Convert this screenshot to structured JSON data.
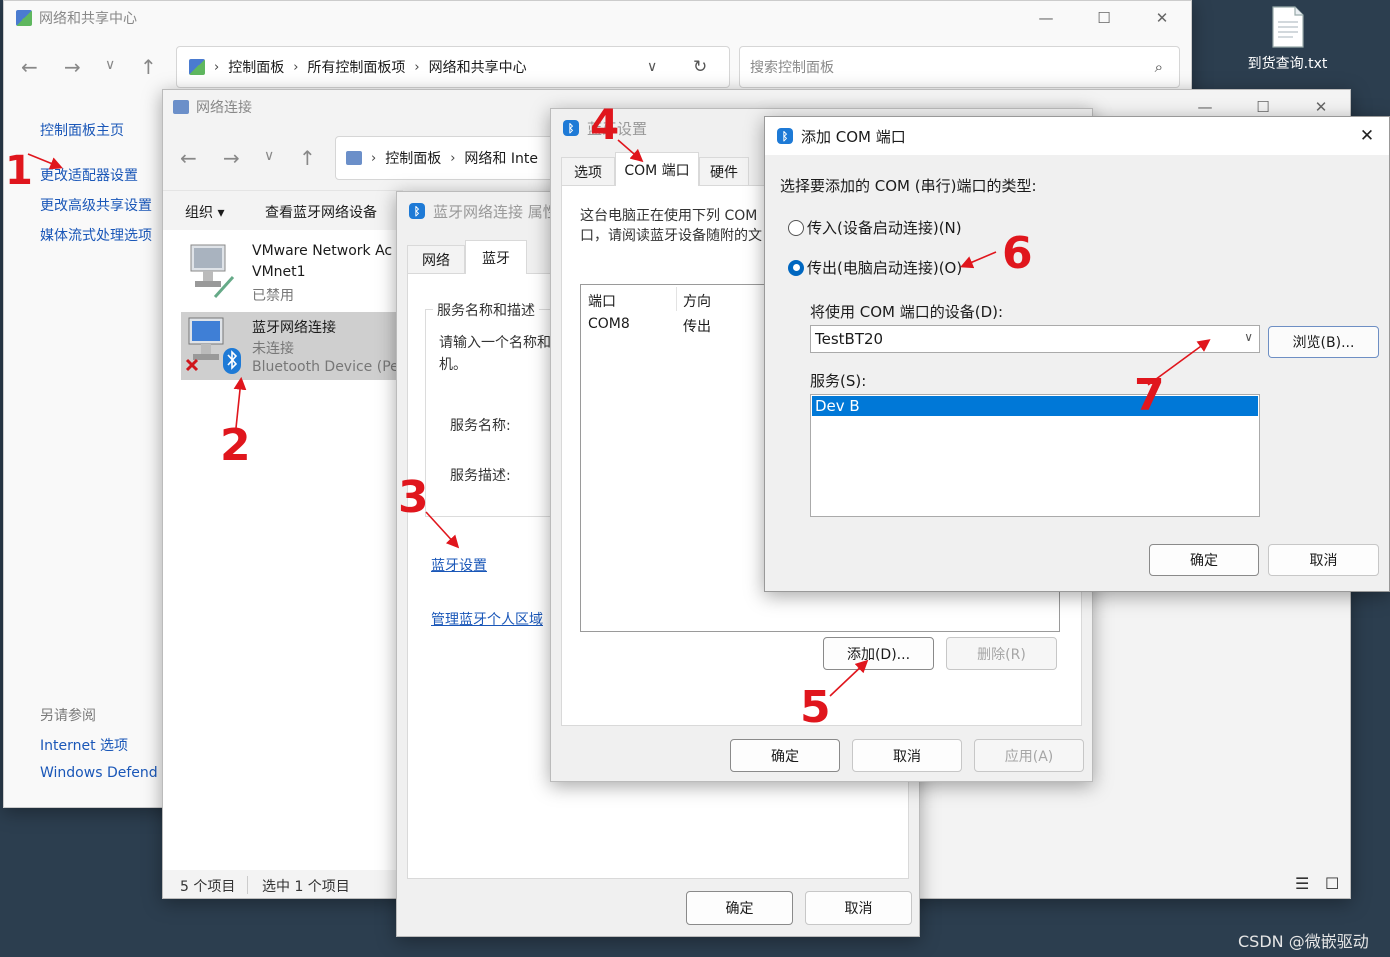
{
  "desktop": {
    "file_label": "到货查询.txt",
    "watermark": "CSDN @微嵌驱动"
  },
  "network_center": {
    "title": "网络和共享中心",
    "breadcrumb": [
      "控制面板",
      "所有控制面板项",
      "网络和共享中心"
    ],
    "search_placeholder": "搜索控制面板",
    "side_links": [
      "控制面板主页",
      "更改适配器设置",
      "更改高级共享设置",
      "媒体流式处理选项"
    ],
    "see_also_title": "另请参阅",
    "see_also": [
      "Internet 选项",
      "Windows Defend"
    ]
  },
  "network_connections": {
    "title": "网络连接",
    "breadcrumb": [
      "控制面板",
      "网络和 Inte"
    ],
    "toolbar": {
      "organize": "组织 ▾",
      "view_bt": "查看蓝牙网络设备"
    },
    "items": [
      {
        "name": "VMware Network Ac",
        "sub1": "VMnet1",
        "sub2": "已禁用"
      },
      {
        "name": "蓝牙网络连接",
        "sub1": "未连接",
        "sub2": "Bluetooth Device (Pe"
      }
    ],
    "status": {
      "count": "5 个项目",
      "selected": "选中 1 个项目"
    }
  },
  "bt_props": {
    "title": "蓝牙网络连接 属性",
    "tabs": [
      "网络",
      "蓝牙"
    ],
    "group_title": "服务名称和描述",
    "prompt": "请输入一个名称和",
    "prompt2": "机。",
    "service_name_label": "服务名称:",
    "service_desc_label": "服务描述:",
    "link_settings": "蓝牙设置",
    "link_pan": "管理蓝牙个人区域",
    "ok": "确定",
    "cancel": "取消"
  },
  "bt_settings": {
    "title": "蓝牙设置",
    "tabs": [
      "选项",
      "COM 端口",
      "硬件"
    ],
    "desc1": "这台电脑正在使用下列 COM",
    "desc2": "口，请阅读蓝牙设备随附的文",
    "columns": [
      "端口",
      "方向"
    ],
    "rows": [
      {
        "port": "COM8",
        "dir": "传出"
      }
    ],
    "add": "添加(D)...",
    "remove": "删除(R)",
    "ok": "确定",
    "cancel": "取消",
    "apply": "应用(A)"
  },
  "add_com": {
    "title": "添加 COM 端口",
    "prompt": "选择要添加的 COM (串行)端口的类型:",
    "option_in": "传入(设备启动连接)(N)",
    "option_out": "传出(电脑启动连接)(O)",
    "selected": "out",
    "device_label": "将使用 COM 端口的设备(D):",
    "device_value": "TestBT20",
    "browse": "浏览(B)...",
    "service_label": "服务(S):",
    "services": [
      "Dev B"
    ],
    "ok": "确定",
    "cancel": "取消"
  },
  "annotations": [
    "1",
    "2",
    "3",
    "4",
    "5",
    "6",
    "7"
  ],
  "colors": {
    "accent": "#0078d7",
    "annotation": "#e0161d",
    "link": "#1a57b8"
  }
}
